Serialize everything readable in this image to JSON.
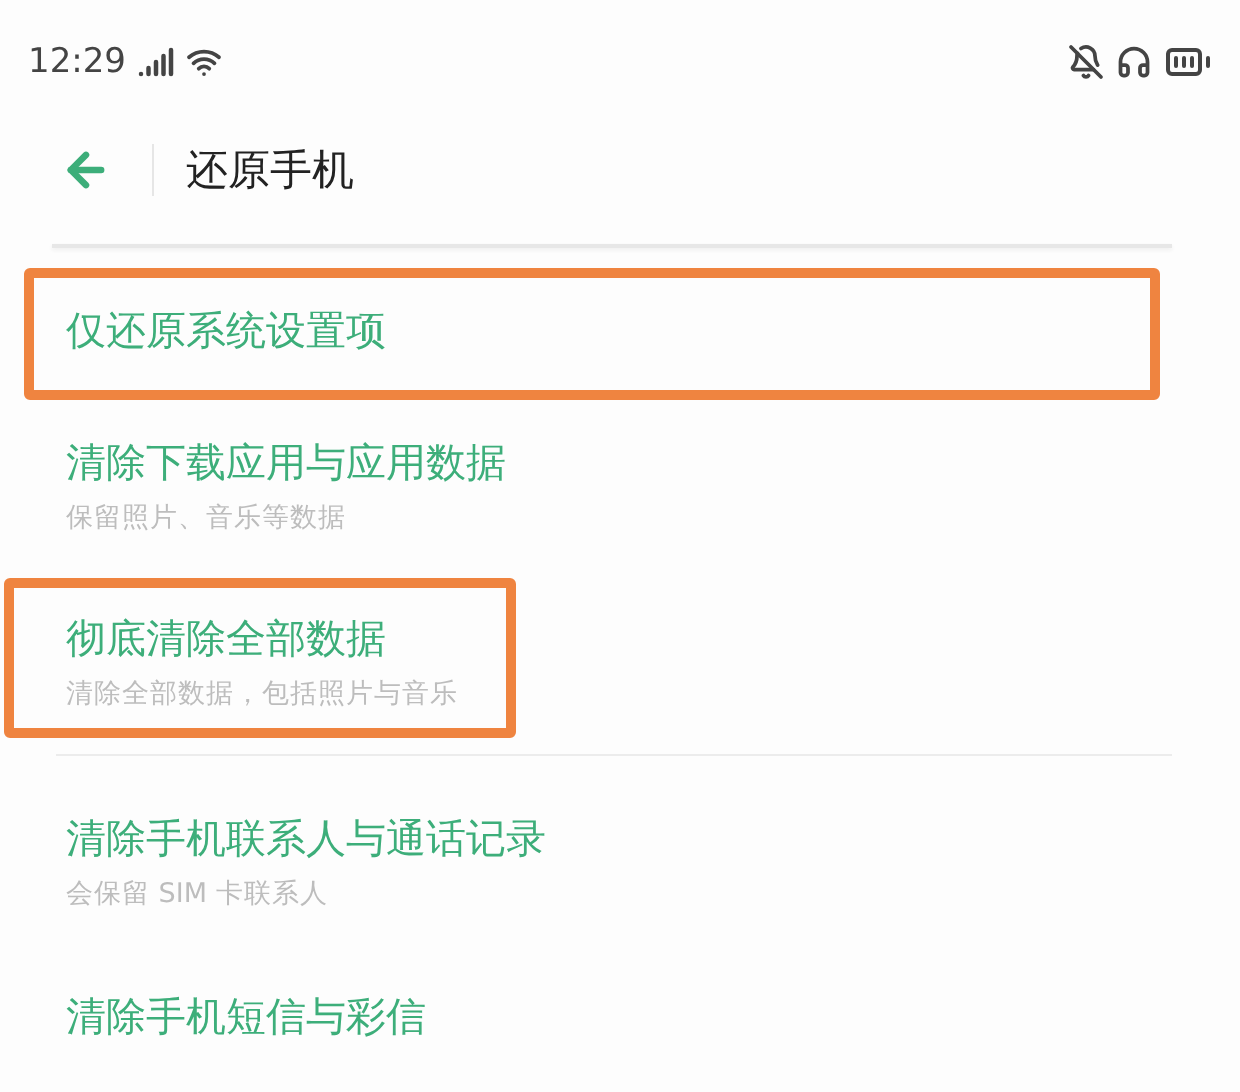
{
  "status_bar": {
    "time": "12:29"
  },
  "header": {
    "title": "还原手机"
  },
  "groups": [
    {
      "items": [
        {
          "title": "仅还原系统设置项",
          "highlighted": true
        },
        {
          "title": "清除下载应用与应用数据",
          "subtitle": "保留照片、音乐等数据",
          "highlighted": false
        },
        {
          "title": "彻底清除全部数据",
          "subtitle": "清除全部数据，包括照片与音乐",
          "highlighted": true
        }
      ]
    },
    {
      "items": [
        {
          "title": "清除手机联系人与通话记录",
          "subtitle": "会保留 SIM 卡联系人",
          "highlighted": false
        },
        {
          "title": "清除手机短信与彩信",
          "highlighted": false
        }
      ]
    }
  ]
}
